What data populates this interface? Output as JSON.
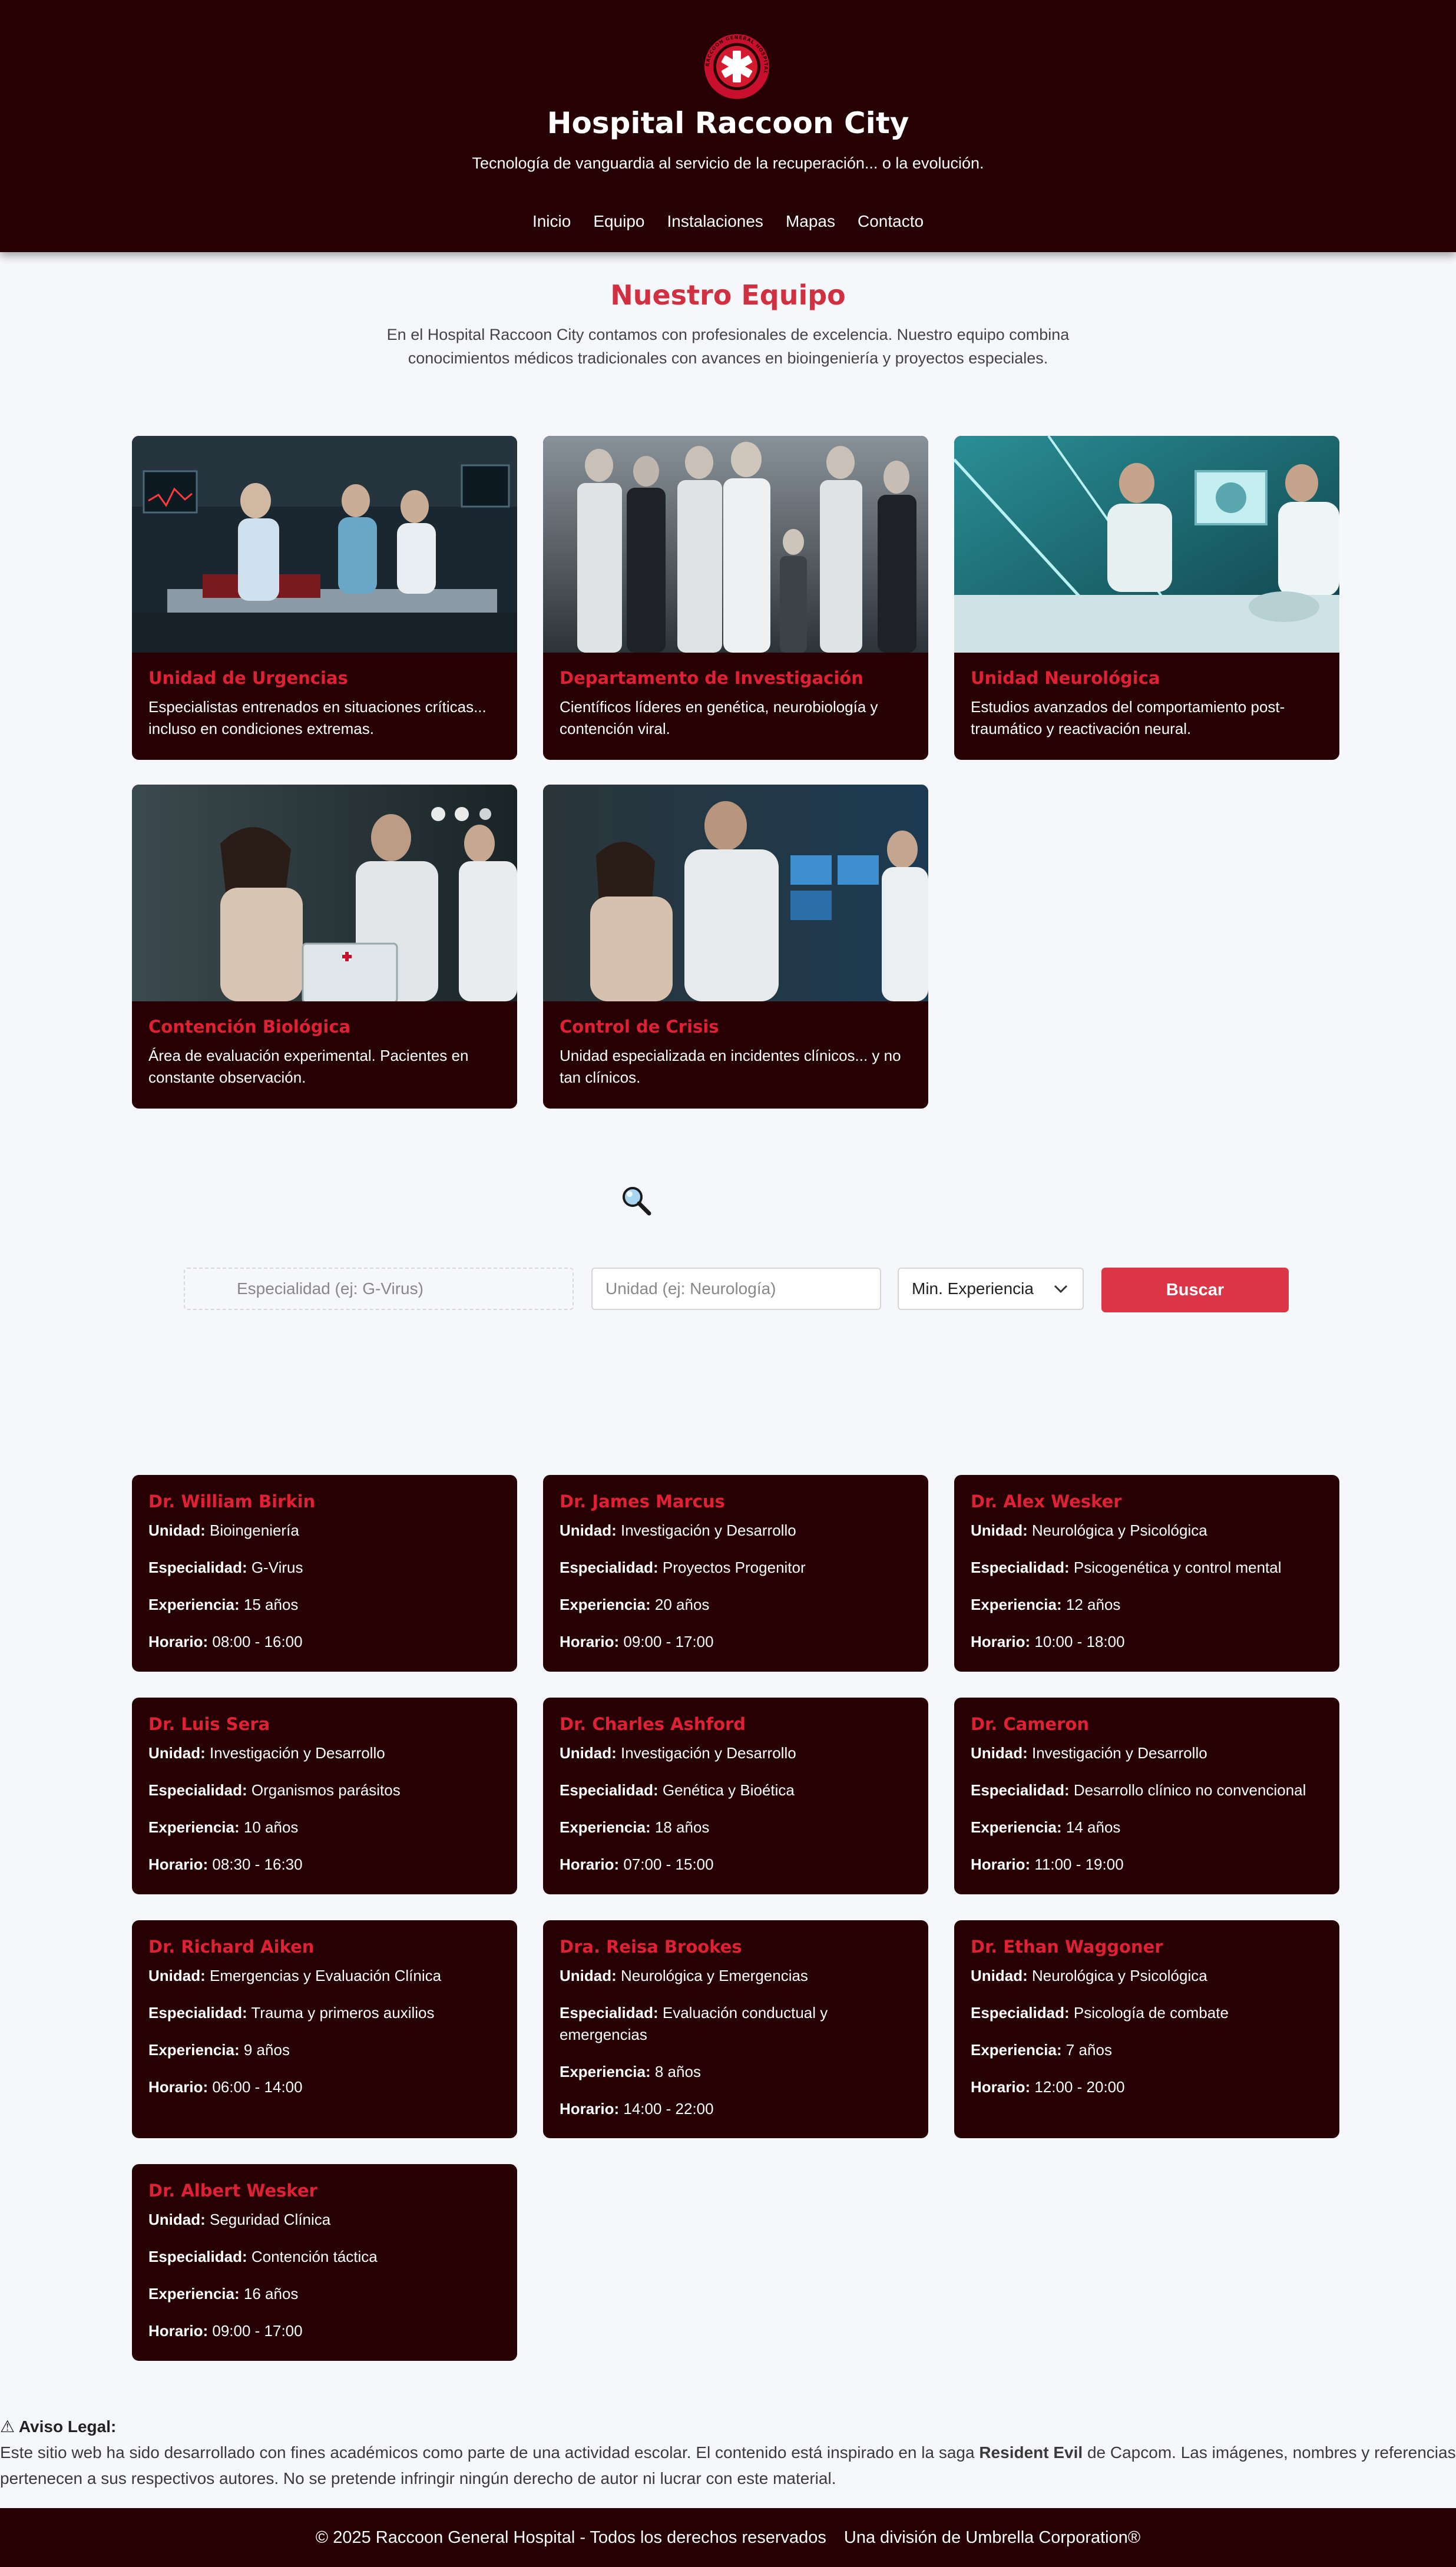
{
  "header": {
    "title": "Hospital Raccoon City",
    "tagline": "Tecnología de vanguardia al servicio de la recuperación... o la evolución.",
    "nav": [
      "Inicio",
      "Equipo",
      "Instalaciones",
      "Mapas",
      "Contacto"
    ],
    "logo_icon": "umbrella-medical-logo-icon",
    "logo_ring_text": "RACCOON GENERAL HOSPITAL"
  },
  "section": {
    "title": "Nuestro Equipo",
    "intro": "En el Hospital Raccoon City contamos con profesionales de excelencia. Nuestro equipo combina conocimientos médicos tradicionales con avances en bioingeniería y proyectos especiales."
  },
  "units": [
    {
      "title": "Unidad de Urgencias",
      "desc": "Especialistas entrenados en situaciones críticas... incluso en condiciones extremas."
    },
    {
      "title": "Departamento de Investigación",
      "desc": "Científicos líderes en genética, neurobiología y contención viral."
    },
    {
      "title": "Unidad Neurológica",
      "desc": "Estudios avanzados del comportamiento post-traumático y reactivación neural."
    },
    {
      "title": "Contención Biológica",
      "desc": "Área de evaluación experimental. Pacientes en constante observación."
    },
    {
      "title": "Control de Crisis",
      "desc": "Unidad especializada en incidentes clínicos... y no tan clínicos."
    }
  ],
  "search": {
    "icon": "magnifier-icon",
    "specialty_placeholder": "Especialidad (ej: G-Virus)",
    "unit_placeholder": "Unidad (ej: Neurología)",
    "experience_selected": "Min. Experiencia",
    "button": "Buscar"
  },
  "labels": {
    "unit": "Unidad:",
    "specialty": "Especialidad:",
    "experience": "Experiencia:",
    "schedule": "Horario:"
  },
  "doctors": [
    {
      "name": "Dr. William Birkin",
      "unit": "Bioingeniería",
      "specialty": "G-Virus",
      "experience": "15 años",
      "schedule": "08:00 - 16:00"
    },
    {
      "name": "Dr. James Marcus",
      "unit": "Investigación y Desarrollo",
      "specialty": "Proyectos Progenitor",
      "experience": "20 años",
      "schedule": "09:00 - 17:00"
    },
    {
      "name": "Dr. Alex Wesker",
      "unit": "Neurológica y Psicológica",
      "specialty": "Psicogenética y control mental",
      "experience": "12 años",
      "schedule": "10:00 - 18:00"
    },
    {
      "name": "Dr. Luis Sera",
      "unit": "Investigación y Desarrollo",
      "specialty": "Organismos parásitos",
      "experience": "10 años",
      "schedule": "08:30 - 16:30"
    },
    {
      "name": "Dr. Charles Ashford",
      "unit": "Investigación y Desarrollo",
      "specialty": "Genética y Bioética",
      "experience": "18 años",
      "schedule": "07:00 - 15:00"
    },
    {
      "name": "Dr. Cameron",
      "unit": "Investigación y Desarrollo",
      "specialty": "Desarrollo clínico no convencional",
      "experience": "14 años",
      "schedule": "11:00 - 19:00"
    },
    {
      "name": "Dr. Richard Aiken",
      "unit": "Emergencias y Evaluación Clínica",
      "specialty": "Trauma y primeros auxilios",
      "experience": "9 años",
      "schedule": "06:00 - 14:00"
    },
    {
      "name": "Dra. Reisa Brookes",
      "unit": "Neurológica y Emergencias",
      "specialty": "Evaluación conductual y emergencias",
      "experience": "8 años",
      "schedule": "14:00 - 22:00"
    },
    {
      "name": "Dr. Ethan Waggoner",
      "unit": "Neurológica y Psicológica",
      "specialty": "Psicología de combate",
      "experience": "7 años",
      "schedule": "12:00 - 20:00"
    },
    {
      "name": "Dr. Albert Wesker",
      "unit": "Seguridad Clínica",
      "specialty": "Contención táctica",
      "experience": "16 años",
      "schedule": "09:00 - 17:00"
    }
  ],
  "legal": {
    "icon": "⚠",
    "title": "Aviso Legal:",
    "text_before": "Este sitio web ha sido desarrollado con fines académicos como parte de una actividad escolar. El contenido está inspirado en la saga ",
    "text_bold": "Resident Evil",
    "text_after": " de Capcom. Las imágenes, nombres y referencias pertenecen a sus respectivos autores. No se pretende infringir ningún derecho de autor ni lucrar con este material."
  },
  "footer": {
    "copyright": "© 2025 Raccoon General Hospital - Todos los derechos reservados",
    "division": "Una división de Umbrella Corporation®"
  },
  "colors": {
    "dark_maroon": "#260002",
    "accent_red": "#e02034",
    "title_red": "#d0303f",
    "button_red": "#dc3545",
    "page_bg": "#f6f7fa"
  }
}
